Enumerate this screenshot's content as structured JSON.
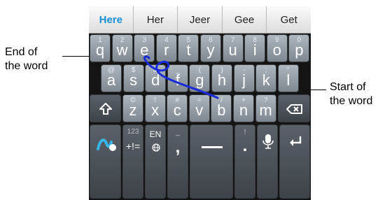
{
  "annotations": {
    "end_of_word": [
      "End of",
      "the word"
    ],
    "start_of_word": [
      "Start of",
      "the word"
    ]
  },
  "suggestions": [
    "Here",
    "Her",
    "Jeer",
    "Gee",
    "Get"
  ],
  "rows": {
    "row1": [
      {
        "main": "q",
        "hint": "1"
      },
      {
        "main": "w",
        "hint": "2"
      },
      {
        "main": "e",
        "hint": "3"
      },
      {
        "main": "r",
        "hint": "4"
      },
      {
        "main": "t",
        "hint": "5"
      },
      {
        "main": "y",
        "hint": "6"
      },
      {
        "main": "u",
        "hint": "7"
      },
      {
        "main": "i",
        "hint": "8"
      },
      {
        "main": "o",
        "hint": "9"
      },
      {
        "main": "p",
        "hint": "0"
      }
    ],
    "row2": [
      {
        "main": "a",
        "hint": "@"
      },
      {
        "main": "s",
        "hint": "$"
      },
      {
        "main": "d",
        "hint": "&"
      },
      {
        "main": "f",
        "hint": "_"
      },
      {
        "main": "g",
        "hint": "("
      },
      {
        "main": "h",
        "hint": ")"
      },
      {
        "main": "j",
        "hint": "-"
      },
      {
        "main": "k",
        "hint": ";"
      },
      {
        "main": "l",
        "hint": "\""
      }
    ],
    "row3": [
      {
        "main": "z",
        "hint": "©"
      },
      {
        "main": "x",
        "hint": "!"
      },
      {
        "main": "c",
        "hint": "#"
      },
      {
        "main": "v",
        "hint": "="
      },
      {
        "main": "b",
        "hint": "/"
      },
      {
        "main": "n",
        "hint": "+"
      },
      {
        "main": "m",
        "hint": "?"
      }
    ]
  },
  "bottom_row": {
    "symbols_hint": "123",
    "symbols_label": "+!=",
    "lang_label": "EN",
    "comma_hint": "_",
    "comma_label": ",",
    "period_hint": "!",
    "period_label": "."
  },
  "icons": {
    "shift": "shift-arrow-icon",
    "backspace": "backspace-icon",
    "swype": "swype-logo-icon",
    "globe": "globe-icon",
    "space": "space-bar-icon",
    "mic": "microphone-icon",
    "enter": "enter-arrow-icon"
  },
  "colors": {
    "trace": "#1a2bd8",
    "active_suggestion": "#1a8fd6"
  }
}
